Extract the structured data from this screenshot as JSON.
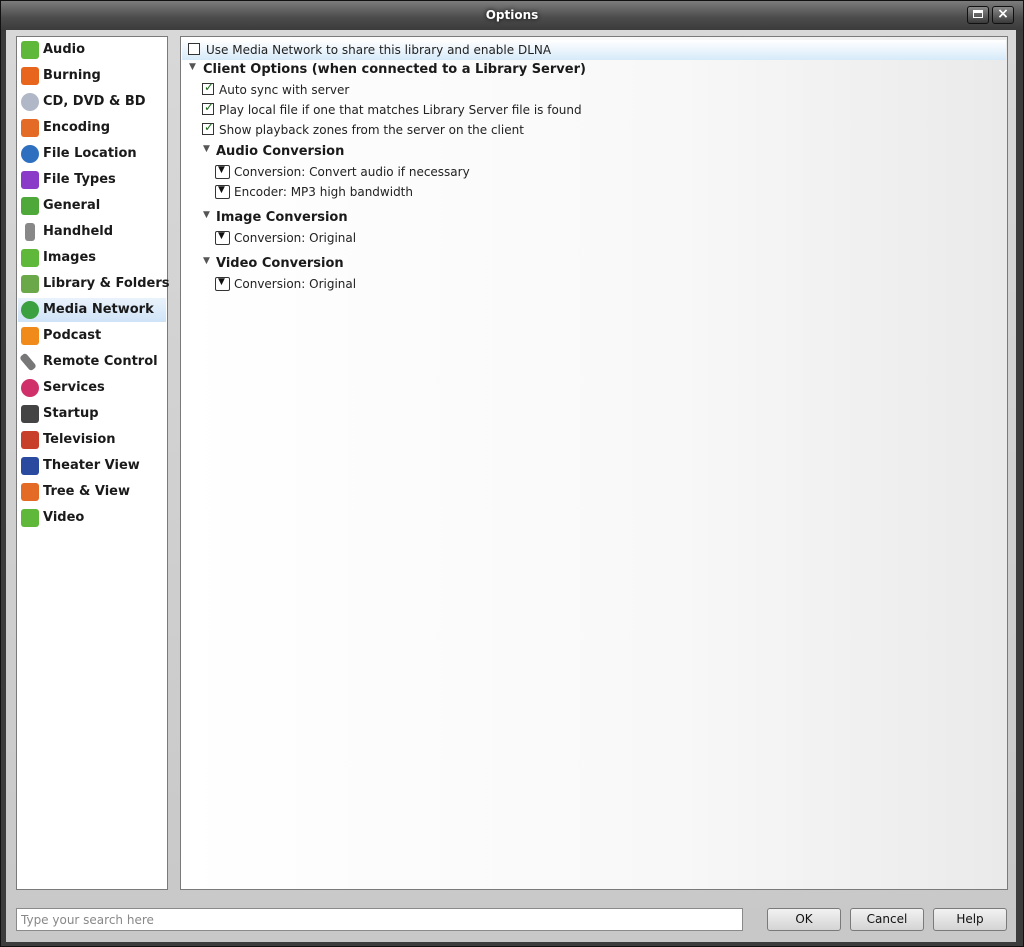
{
  "window": {
    "title": "Options"
  },
  "sidebar": {
    "items": [
      {
        "label": "Audio",
        "icon": "audio-icon",
        "color": "#5fb83a"
      },
      {
        "label": "Burning",
        "icon": "burning-icon",
        "color": "#e8651d"
      },
      {
        "label": "CD, DVD & BD",
        "icon": "disc-icon",
        "color": "#b0b8c8"
      },
      {
        "label": "Encoding",
        "icon": "encoding-icon",
        "color": "#e46b25"
      },
      {
        "label": "File Location",
        "icon": "file-location-icon",
        "color": "#2e6fc0"
      },
      {
        "label": "File Types",
        "icon": "file-types-icon",
        "color": "#8a3cc8"
      },
      {
        "label": "General",
        "icon": "general-icon",
        "color": "#4fa83a"
      },
      {
        "label": "Handheld",
        "icon": "handheld-icon",
        "color": "#888888"
      },
      {
        "label": "Images",
        "icon": "images-icon",
        "color": "#5fb83a"
      },
      {
        "label": "Library & Folders",
        "icon": "library-icon",
        "color": "#6aa84a"
      },
      {
        "label": "Media Network",
        "icon": "media-network-icon",
        "color": "#3aa040"
      },
      {
        "label": "Podcast",
        "icon": "podcast-icon",
        "color": "#f08a1a"
      },
      {
        "label": "Remote Control",
        "icon": "remote-control-icon",
        "color": "#777777"
      },
      {
        "label": "Services",
        "icon": "services-icon",
        "color": "#d0306a"
      },
      {
        "label": "Startup",
        "icon": "startup-icon",
        "color": "#444444"
      },
      {
        "label": "Television",
        "icon": "television-icon",
        "color": "#c8402a"
      },
      {
        "label": "Theater View",
        "icon": "theater-view-icon",
        "color": "#2a4aa0"
      },
      {
        "label": "Tree & View",
        "icon": "tree-view-icon",
        "color": "#e46b25"
      },
      {
        "label": "Video",
        "icon": "video-icon",
        "color": "#5fb83a"
      }
    ],
    "selected": "Media Network"
  },
  "settings": {
    "use_media_network": {
      "label": "Use Media Network to share this library and enable DLNA",
      "checked": false
    },
    "client_options": {
      "title": "Client Options (when connected to a Library Server)",
      "auto_sync": {
        "label": "Auto sync with server",
        "checked": true
      },
      "play_local": {
        "label": "Play local file if one that matches Library Server file is found",
        "checked": true
      },
      "show_zones": {
        "label": "Show playback zones from the server on the client",
        "checked": true
      },
      "audio_conversion": {
        "title": "Audio Conversion",
        "conversion": "Conversion: Convert audio if necessary",
        "encoder": "Encoder: MP3 high bandwidth"
      },
      "image_conversion": {
        "title": "Image Conversion",
        "conversion": "Conversion: Original"
      },
      "video_conversion": {
        "title": "Video Conversion",
        "conversion": "Conversion: Original"
      }
    }
  },
  "search": {
    "placeholder": "Type your search here",
    "value": ""
  },
  "buttons": {
    "ok": "OK",
    "cancel": "Cancel",
    "help": "Help"
  }
}
